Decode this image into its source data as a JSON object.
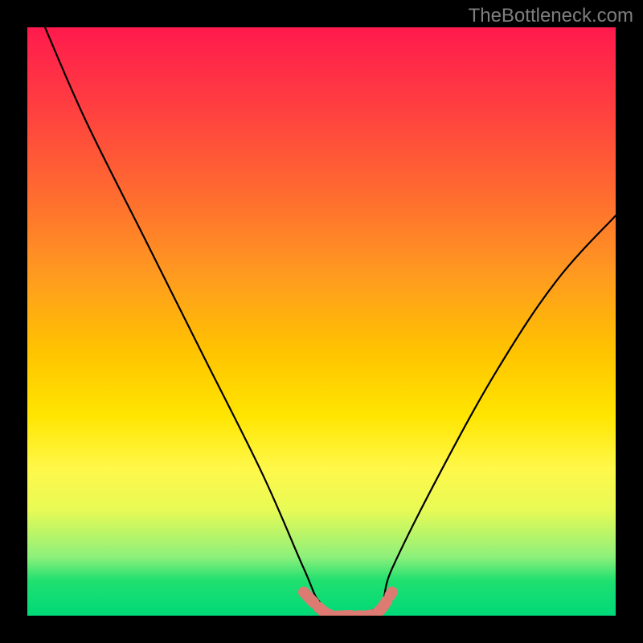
{
  "attribution": "TheBottleneck.com",
  "chart_data": {
    "type": "line",
    "title": "",
    "xlabel": "",
    "ylabel": "",
    "xlim": [
      0,
      100
    ],
    "ylim": [
      0,
      100
    ],
    "grid": false,
    "series": [
      {
        "name": "bottleneck-curve",
        "x": [
          3,
          10,
          20,
          30,
          40,
          47,
          50,
          55,
          60,
          62,
          70,
          80,
          90,
          100
        ],
        "values": [
          100,
          84,
          64,
          44,
          24,
          8,
          2,
          0,
          2,
          8,
          24,
          42,
          57,
          68
        ]
      }
    ],
    "highlight": {
      "name": "optimal-band",
      "x": [
        47,
        50,
        52,
        55,
        58,
        60,
        62
      ],
      "values": [
        4,
        1,
        0,
        0,
        0,
        1,
        4
      ]
    },
    "background_gradient": {
      "top_color": "#ff1a4d",
      "bottom_color": "#00d978"
    },
    "curve_color": "#000000",
    "highlight_color": "#dd7b73"
  }
}
